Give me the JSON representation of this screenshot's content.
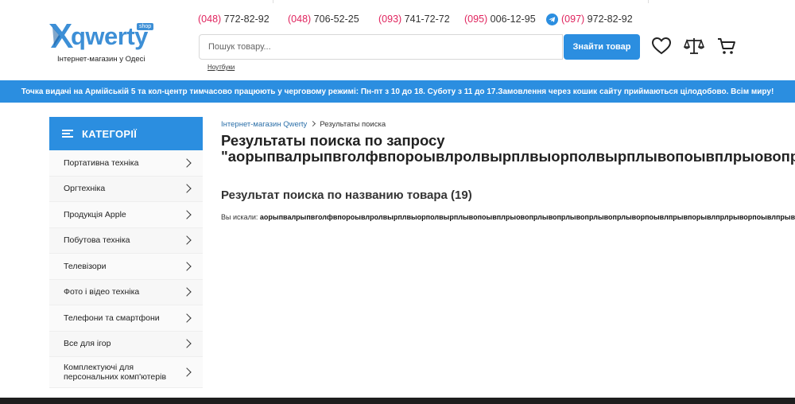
{
  "logo": {
    "word": "qwerty",
    "badge": "shop",
    "tagline": "Інтернет-магазин у Одесі"
  },
  "phones": [
    {
      "code": "(048)",
      "number": " 772-82-92"
    },
    {
      "code": "(048)",
      "number": " 706-52-25"
    },
    {
      "code": "(093)",
      "number": " 741-72-72"
    },
    {
      "code": "(095)",
      "number": " 006-12-95"
    },
    {
      "code": "(097)",
      "number": " 972-82-92"
    }
  ],
  "search": {
    "placeholder": "Пошук товару...",
    "button_label": "Знайти товар",
    "hint": "Ноутбуки"
  },
  "header_icons": [
    "heart-icon",
    "scales-icon",
    "cart-icon"
  ],
  "banner": {
    "text": "Точка видачі на Армійській 5 та кол-центр тимчасово працюють у черговому режимі: Пн-пт з 10 до 18. Суботу з 11 до 17.Замовлення через кошик сайту приймаються цілодобово. Всім миру!"
  },
  "sidebar": {
    "title": "КАТЕГОРІЇ",
    "items": [
      {
        "label": "Портативна техніка"
      },
      {
        "label": "Оргтехніка"
      },
      {
        "label": "Продукція Apple"
      },
      {
        "label": "Побутова техніка"
      },
      {
        "label": "Телевізори"
      },
      {
        "label": "Фото і відео техніка"
      },
      {
        "label": "Телефони та смартфони"
      },
      {
        "label": "Все для ігор"
      },
      {
        "label": "Комплектуючі для персональних комп'ютерів"
      }
    ]
  },
  "breadcrumb": {
    "home": "Інтернет-магазин Qwerty",
    "current": "Результаты поиска"
  },
  "main": {
    "title_line1": "Результаты поиска по запросу",
    "title_line2": "\"аорыпвалрыпвголфвпороывлролвырплвыорполвырплывопоывплрыовопрлыво",
    "section_title": "Результат поиска по названию товара (19)",
    "searched_label": "Вы искали: ",
    "searched_query": "аорыпвалрыпвголфвпороывлролвырплвыорполвырплывопоывплрыовопрлывопрлывопрлывопрлыворпоывлпрывпорывлпрлрыворпоывлпрыволрпывп"
  },
  "colors": {
    "accent": "#2b8ee0",
    "phone_code": "#e0245e",
    "logo": "#3d8fd6"
  }
}
